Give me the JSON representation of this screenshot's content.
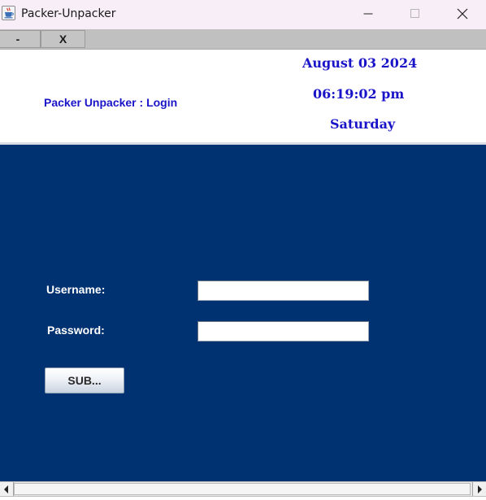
{
  "window": {
    "title": "Packer-Unpacker",
    "icon": "java-cup-icon"
  },
  "toolbar": {
    "minimize_label": "-",
    "close_label": "X"
  },
  "header": {
    "title": "Packer Unpacker : Login",
    "date": "August 03 2024",
    "time": "06:19:02 pm",
    "day": "Saturday"
  },
  "login": {
    "username_label": "Username:",
    "username_value": "",
    "password_label": "Password:",
    "password_value": "",
    "submit_label": "SUB..."
  },
  "colors": {
    "panel_bg": "#003171",
    "header_text": "#1a14c8",
    "toolbar_bg": "#c0c0c0",
    "titlebar_bg": "#f7eef7"
  }
}
